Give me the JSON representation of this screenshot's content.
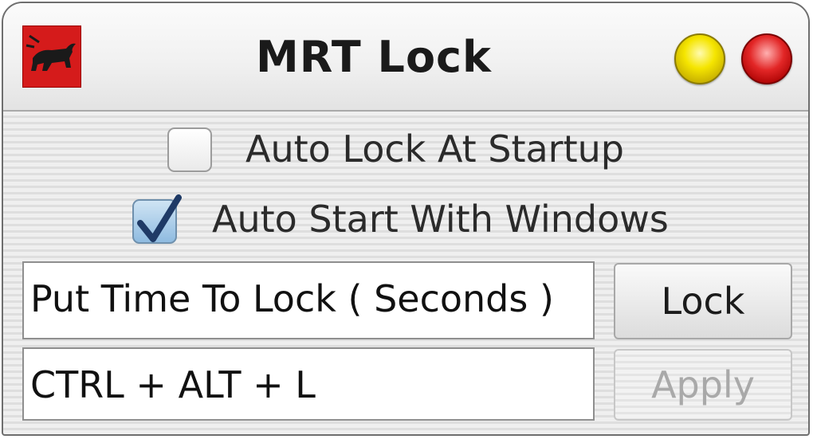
{
  "window": {
    "title": "MRT Lock",
    "buttons": {
      "minimize_icon": "yellow-orb",
      "close_icon": "red-orb"
    },
    "app_icon": "bull-icon"
  },
  "options": {
    "auto_lock": {
      "label": "Auto Lock At Startup",
      "checked": false
    },
    "auto_start": {
      "label": "Auto Start With Windows",
      "checked": true
    }
  },
  "time_field": {
    "value": "Put Time To Lock ( Seconds )"
  },
  "hotkey_field": {
    "value": "CTRL + ALT + L"
  },
  "actions": {
    "lock_label": "Lock",
    "apply_label": "Apply",
    "apply_enabled": false
  },
  "colors": {
    "accent_red": "#d51b1b",
    "minimize_yellow": "#f5e500",
    "close_red": "#e22626",
    "check_blue": "#1f3a66"
  }
}
